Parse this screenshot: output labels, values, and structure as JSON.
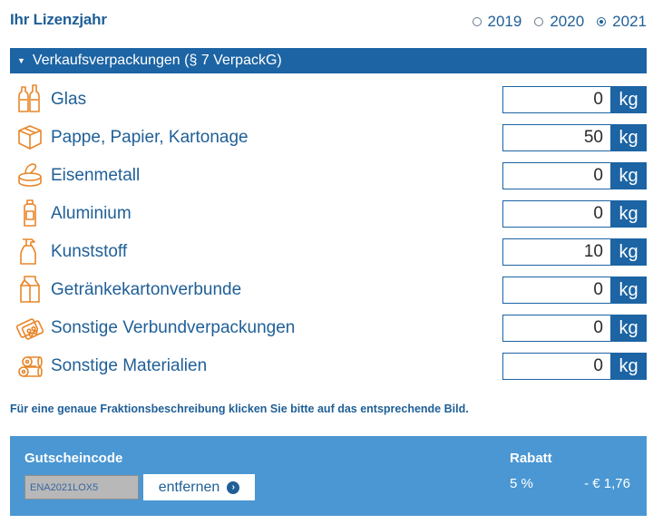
{
  "header": {
    "title": "Ihr Lizenzjahr",
    "years": [
      {
        "label": "2019",
        "selected": false
      },
      {
        "label": "2020",
        "selected": false
      },
      {
        "label": "2021",
        "selected": true
      }
    ]
  },
  "section": {
    "title": "Verkaufsverpackungen (§ 7 VerpackG)"
  },
  "colors": {
    "primary": "#1c64a4",
    "text": "#1f5f97",
    "icon": "#e8862a",
    "voucher_bg": "#4a97d3"
  },
  "materials": [
    {
      "label": "Glas",
      "value": "0",
      "unit": "kg",
      "icon": "bottles-icon"
    },
    {
      "label": "Pappe, Papier, Kartonage",
      "value": "50",
      "unit": "kg",
      "icon": "box-icon"
    },
    {
      "label": "Eisenmetall",
      "value": "0",
      "unit": "kg",
      "icon": "tin-can-icon"
    },
    {
      "label": "Aluminium",
      "value": "0",
      "unit": "kg",
      "icon": "spray-can-icon"
    },
    {
      "label": "Kunststoff",
      "value": "10",
      "unit": "kg",
      "icon": "spray-bottle-icon"
    },
    {
      "label": "Getränkekartonverbunde",
      "value": "0",
      "unit": "kg",
      "icon": "milk-carton-icon"
    },
    {
      "label": "Sonstige Verbundverpackungen",
      "value": "0",
      "unit": "kg",
      "icon": "blister-pack-icon"
    },
    {
      "label": "Sonstige Materialien",
      "value": "0",
      "unit": "kg",
      "icon": "rolls-icon"
    }
  ],
  "hint": "Für eine genaue Fraktionsbeschreibung klicken Sie bitte auf das entsprechende Bild.",
  "voucher": {
    "label": "Gutscheincode",
    "code": "ENA2021LOX5",
    "remove_label": "entfernen",
    "rabatt_label": "Rabatt",
    "rabatt_percent": "5 %",
    "rabatt_amount": "- € 1,76"
  }
}
